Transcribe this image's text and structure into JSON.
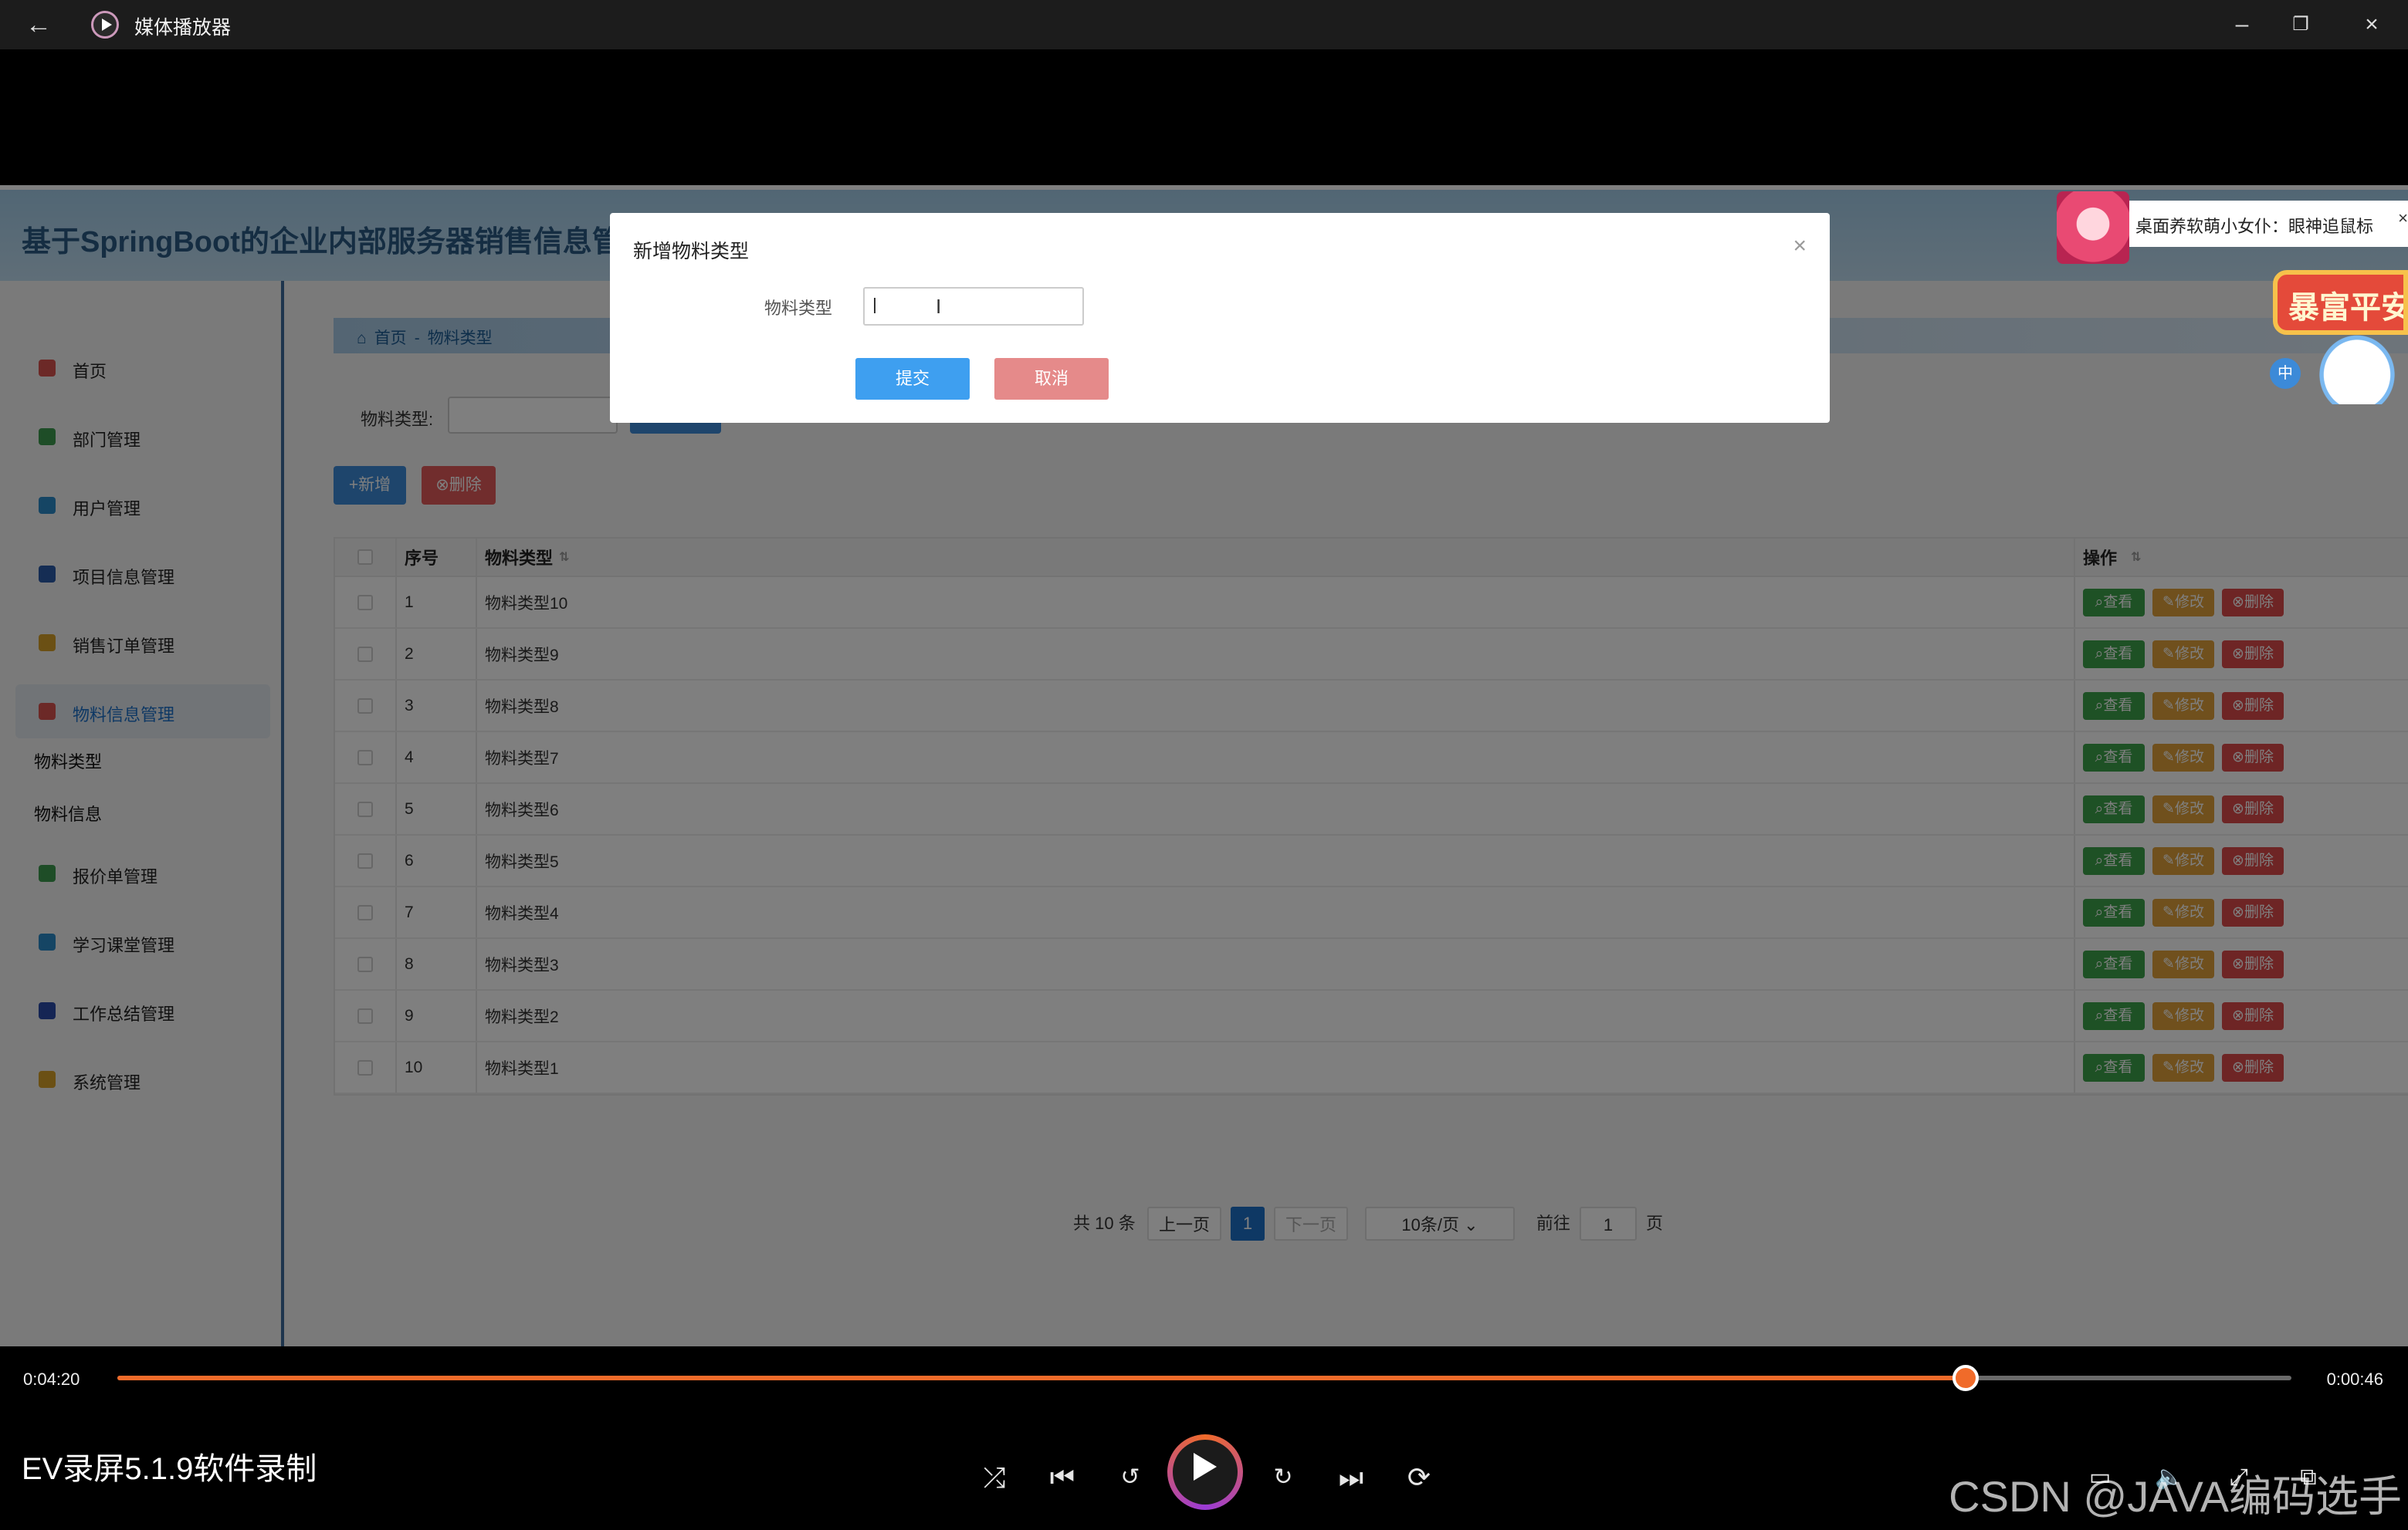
{
  "window": {
    "title": "媒体播放器",
    "back_icon": "arrow-left-icon",
    "minimize_icon": "minimize-icon",
    "restore_icon": "restore-icon",
    "close_icon": "close-icon"
  },
  "app": {
    "brand": "基于SpringBoot的企业内部服务器销售信息管理",
    "sidebar": {
      "items": [
        {
          "label": "首页",
          "icon": "home-icon",
          "color": "#d9534f"
        },
        {
          "label": "部门管理",
          "icon": "department-icon",
          "color": "#3c9a4e"
        },
        {
          "label": "用户管理",
          "icon": "user-icon",
          "color": "#2a8ac9"
        },
        {
          "label": "项目信息管理",
          "icon": "project-icon",
          "color": "#2a5aa8"
        },
        {
          "label": "销售订单管理",
          "icon": "order-icon",
          "color": "#d6a028"
        },
        {
          "label": "物料信息管理",
          "icon": "material-icon",
          "color": "#d9534f",
          "active": true
        },
        {
          "label": "报价单管理",
          "icon": "quote-icon",
          "color": "#3c9a4e"
        },
        {
          "label": "学习课堂管理",
          "icon": "classroom-icon",
          "color": "#2a8ac9"
        },
        {
          "label": "工作总结管理",
          "icon": "summary-icon",
          "color": "#2a4aa8"
        },
        {
          "label": "系统管理",
          "icon": "system-icon",
          "color": "#d6a028"
        }
      ],
      "subitems": [
        "物料类型",
        "物料信息"
      ]
    },
    "breadcrumb": {
      "home": "首页",
      "sep": "-",
      "current": "物料类型"
    },
    "search": {
      "label": "物料类型:",
      "button": "搜索"
    },
    "actions": {
      "add": "+新增",
      "delete": "⊗删除"
    },
    "table": {
      "headers": {
        "index": "序号",
        "name": "物料类型",
        "ops": "操作"
      },
      "rows": [
        {
          "idx": "1",
          "name": "物料类型10"
        },
        {
          "idx": "2",
          "name": "物料类型9"
        },
        {
          "idx": "3",
          "name": "物料类型8"
        },
        {
          "idx": "4",
          "name": "物料类型7"
        },
        {
          "idx": "5",
          "name": "物料类型6"
        },
        {
          "idx": "6",
          "name": "物料类型5"
        },
        {
          "idx": "7",
          "name": "物料类型4"
        },
        {
          "idx": "8",
          "name": "物料类型3"
        },
        {
          "idx": "9",
          "name": "物料类型2"
        },
        {
          "idx": "10",
          "name": "物料类型1"
        }
      ],
      "ops": {
        "view": "查看",
        "edit": "修改",
        "delete": "删除"
      }
    },
    "pagination": {
      "total": "共 10 条",
      "prev": "上一页",
      "current": "1",
      "next": "下一页",
      "size": "10条/页",
      "goto": "前往",
      "goto_value": "1",
      "page_unit": "页"
    }
  },
  "modal": {
    "title": "新增物料类型",
    "field_label": "物料类型",
    "field_value": "",
    "submit": "提交",
    "cancel": "取消"
  },
  "ad": {
    "text": "桌面养软萌小女仆：眼神追鼠标",
    "close": "×",
    "fortune": "暴富平安",
    "ime": "中"
  },
  "player": {
    "current_time": "0:04:20",
    "remaining_time": "0:00:46",
    "progress_fraction": 0.85,
    "media_title": "EV录屏5.1.9软件录制",
    "watermark": "CSDN @JAVA编码选手",
    "accent": "#f06b2a"
  }
}
